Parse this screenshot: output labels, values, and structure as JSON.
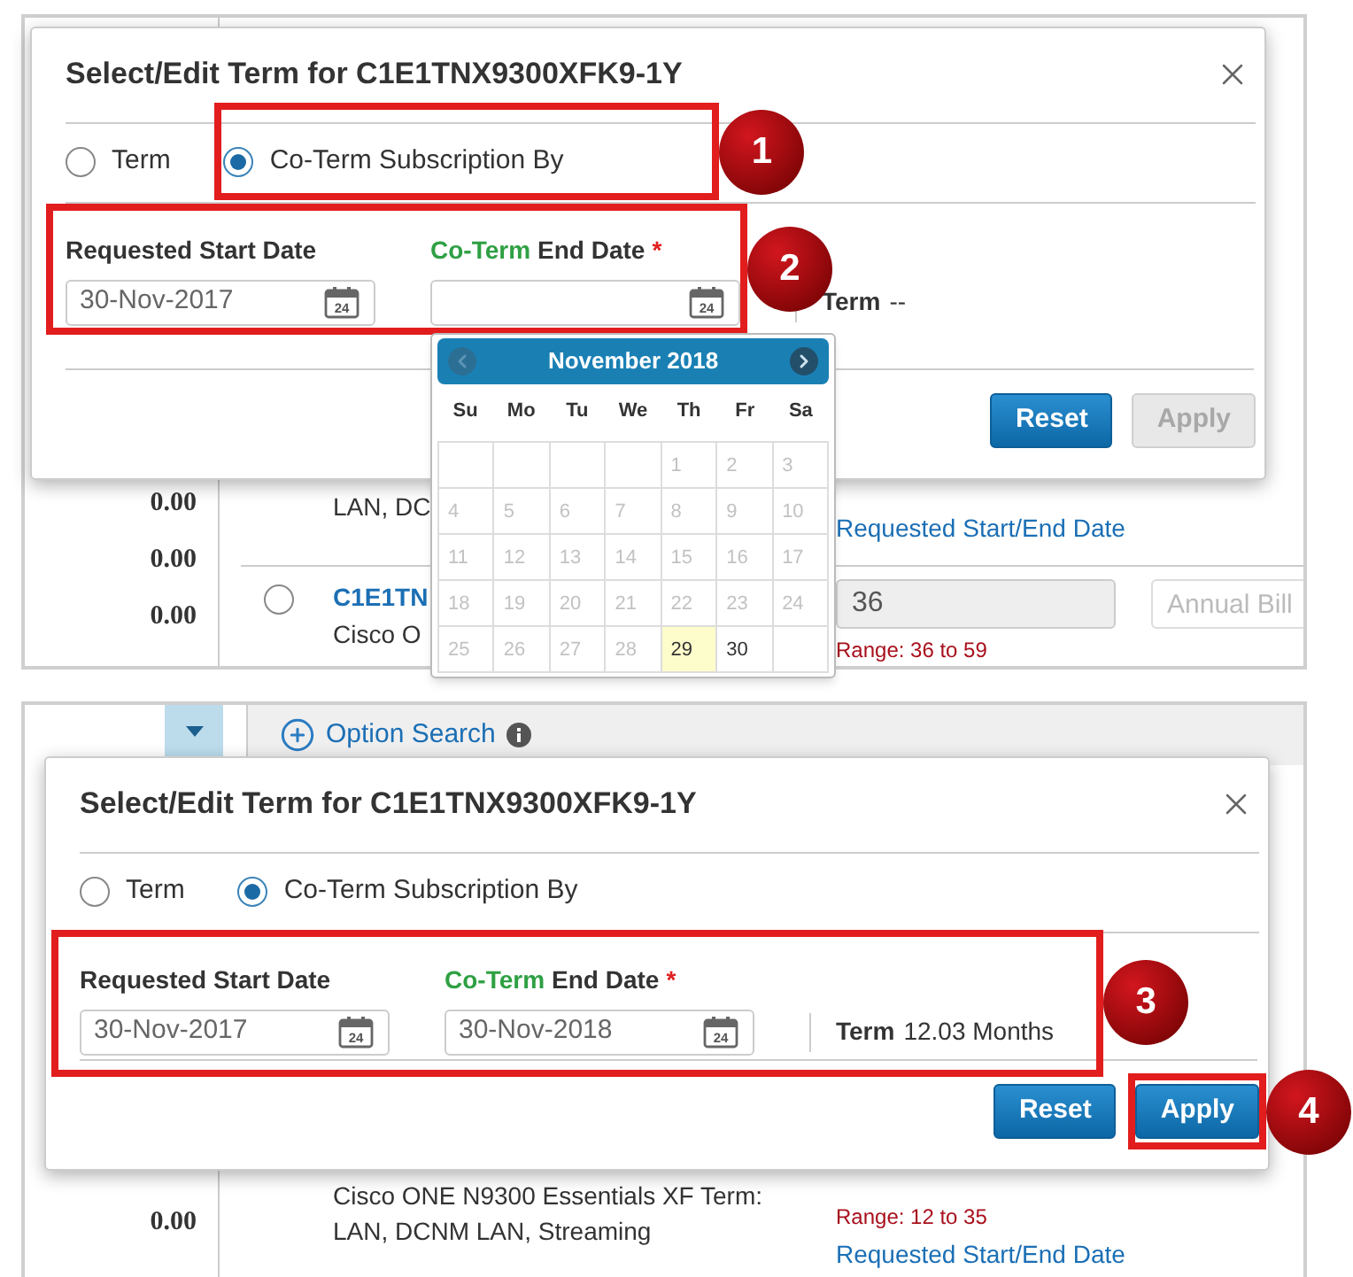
{
  "screens": [
    {
      "background": {
        "amounts": [
          "0.00",
          "0.00",
          "0.00"
        ],
        "rows": [
          {
            "description": "LAN, DC",
            "link": "Requested Start/End Date"
          },
          {
            "radio_selected": false,
            "title": "C1E1TN",
            "description": "Cisco O",
            "term_value": "36",
            "range": "Range: 36 to 59",
            "billing_placeholder": "Annual Bill"
          }
        ]
      },
      "dialog": {
        "title": "Select/Edit Term for C1E1TNX9300XFK9-1Y",
        "options": [
          {
            "label": "Term",
            "selected": false
          },
          {
            "label": "Co-Term Subscription By",
            "selected": true,
            "callout": "1"
          }
        ],
        "dates": {
          "callout": "2",
          "fields": [
            {
              "label": "Requested Start Date",
              "value": "30-Nov-2017",
              "icon_day": "24"
            },
            {
              "label_highlight": "Co-Term",
              "label": "End Date",
              "required_mark": "*",
              "icon_day": "24",
              "calendar": {
                "month": "November 2018",
                "prev_disabled": true,
                "weekdays": [
                  "Su",
                  "Mo",
                  "Tu",
                  "We",
                  "Th",
                  "Fr",
                  "Sa"
                ],
                "weeks": [
                  [
                    {
                      "label": "1",
                      "disabled": true,
                      "today": false
                    },
                    {
                      "label": "2",
                      "disabled": true,
                      "today": false
                    },
                    {
                      "label": "3",
                      "disabled": true,
                      "today": false
                    }
                  ],
                  [
                    {
                      "label": "4",
                      "disabled": true,
                      "today": false
                    },
                    {
                      "label": "5",
                      "disabled": true,
                      "today": false
                    },
                    {
                      "label": "6",
                      "disabled": true,
                      "today": false
                    },
                    {
                      "label": "7",
                      "disabled": true,
                      "today": false
                    },
                    {
                      "label": "8",
                      "disabled": true,
                      "today": false
                    },
                    {
                      "label": "9",
                      "disabled": true,
                      "today": false
                    },
                    {
                      "label": "10",
                      "disabled": true,
                      "today": false
                    }
                  ],
                  [
                    {
                      "label": "11",
                      "disabled": true,
                      "today": false
                    },
                    {
                      "label": "12",
                      "disabled": true,
                      "today": false
                    },
                    {
                      "label": "13",
                      "disabled": true,
                      "today": false
                    },
                    {
                      "label": "14",
                      "disabled": true,
                      "today": false
                    },
                    {
                      "label": "15",
                      "disabled": true,
                      "today": false
                    },
                    {
                      "label": "16",
                      "disabled": true,
                      "today": false
                    },
                    {
                      "label": "17",
                      "disabled": true,
                      "today": false
                    }
                  ],
                  [
                    {
                      "label": "18",
                      "disabled": true,
                      "today": false
                    },
                    {
                      "label": "19",
                      "disabled": true,
                      "today": false
                    },
                    {
                      "label": "20",
                      "disabled": true,
                      "today": false
                    },
                    {
                      "label": "21",
                      "disabled": true,
                      "today": false
                    },
                    {
                      "label": "22",
                      "disabled": true,
                      "today": false
                    },
                    {
                      "label": "23",
                      "disabled": true,
                      "today": false
                    },
                    {
                      "label": "24",
                      "disabled": true,
                      "today": false
                    }
                  ],
                  [
                    {
                      "label": "25",
                      "disabled": true,
                      "today": false
                    },
                    {
                      "label": "26",
                      "disabled": true,
                      "today": false
                    },
                    {
                      "label": "27",
                      "disabled": true,
                      "today": false
                    },
                    {
                      "label": "28",
                      "disabled": true,
                      "today": false
                    },
                    {
                      "label": "29",
                      "disabled": false,
                      "today": true
                    },
                    {
                      "label": "30",
                      "disabled": false,
                      "today": false
                    }
                  ]
                ]
              }
            }
          ]
        },
        "term": {
          "label": "Term",
          "value": "--"
        },
        "buttons": [
          {
            "label": "Reset",
            "disabled": false
          },
          {
            "label": "Apply",
            "disabled": true
          }
        ]
      }
    },
    {
      "toolbar": {
        "search_label": "Option Search"
      },
      "background": {
        "amounts": [
          "0.00"
        ],
        "rows": [
          {
            "description": "Cisco ONE N9300 Essentials XF Term: LAN, DCNM LAN, Streaming",
            "range": "Range: 12 to 35",
            "link": "Requested Start/End Date"
          }
        ]
      },
      "dialog": {
        "title": "Select/Edit Term for C1E1TNX9300XFK9-1Y",
        "options": [
          {
            "label": "Term",
            "selected": false
          },
          {
            "label": "Co-Term Subscription By",
            "selected": true
          }
        ],
        "dates": {
          "callout": "3",
          "fields": [
            {
              "label": "Requested Start Date",
              "value": "30-Nov-2017",
              "icon_day": "24"
            },
            {
              "label_highlight": "Co-Term",
              "label": "End Date",
              "required_mark": "*",
              "value": "30-Nov-2018",
              "icon_day": "24"
            }
          ],
          "term": {
            "label": "Term",
            "value": "12.03 Months"
          }
        },
        "buttons": [
          {
            "label": "Reset",
            "disabled": false
          },
          {
            "label": "Apply",
            "disabled": false,
            "callout": "4"
          }
        ]
      }
    }
  ]
}
